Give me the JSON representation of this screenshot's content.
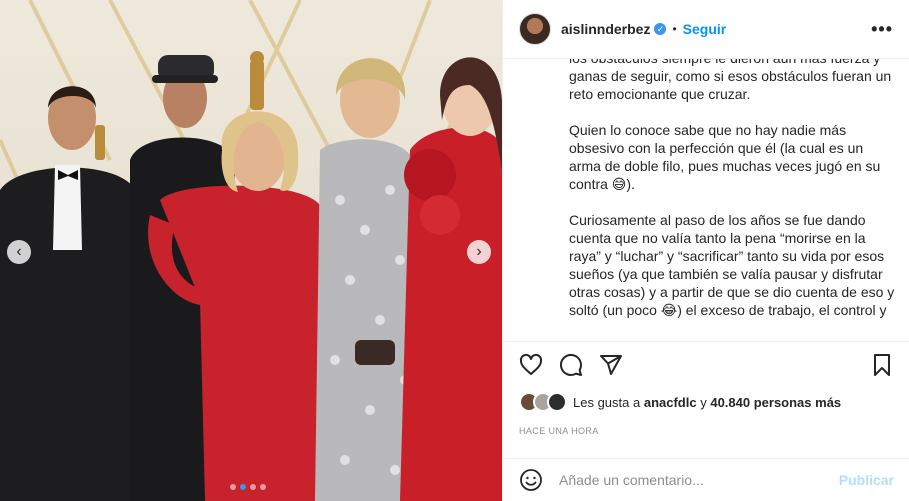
{
  "post": {
    "username": "aislinnderbez",
    "verified_mark": "✓",
    "separator": "•",
    "follow_label": "Seguir",
    "more_label": "•••"
  },
  "caption": {
    "paragraphs": [
      "los obstáculos siempre le dieron aún más fuerza y ganas de seguir, como si esos obstáculos fueran un reto emocionante que cruzar.",
      "Quien lo conoce sabe que no hay nadie más obsesivo con la perfección que él (la cual es un arma de doble filo, pues muchas veces jugó en su contra 😅).",
      "Curiosamente al paso de los años se fue dando cuenta que no valía tanto la pena “morirse en la raya” y “luchar” y “sacrificar” tanto su vida por esos sueños (ya que también se valía pausar y disfrutar otras cosas) y a partir de que se dio cuenta de eso y soltó (un poco 😂) el exceso de trabajo, el control y"
    ]
  },
  "likes": {
    "prefix": "Les gusta a",
    "user": "anacfdlc",
    "joiner": "y",
    "count_text": "40.840 personas más"
  },
  "timestamp": "HACE UNA HORA",
  "comment_box": {
    "placeholder": "Añade un comentario...",
    "publish_label": "Publicar"
  },
  "carousel": {
    "prev_glyph": "‹",
    "next_glyph": "›",
    "slide_count": 4,
    "active_slide": 2
  },
  "icons": {
    "like": "heart-icon",
    "comment": "comment-icon",
    "share": "share-icon",
    "save": "bookmark-icon",
    "emoji": "smiley-icon"
  },
  "colors": {
    "accent": "#0095f6",
    "publish_disabled": "#b2dffc",
    "muted": "#8e8e8e",
    "text": "#262626"
  }
}
